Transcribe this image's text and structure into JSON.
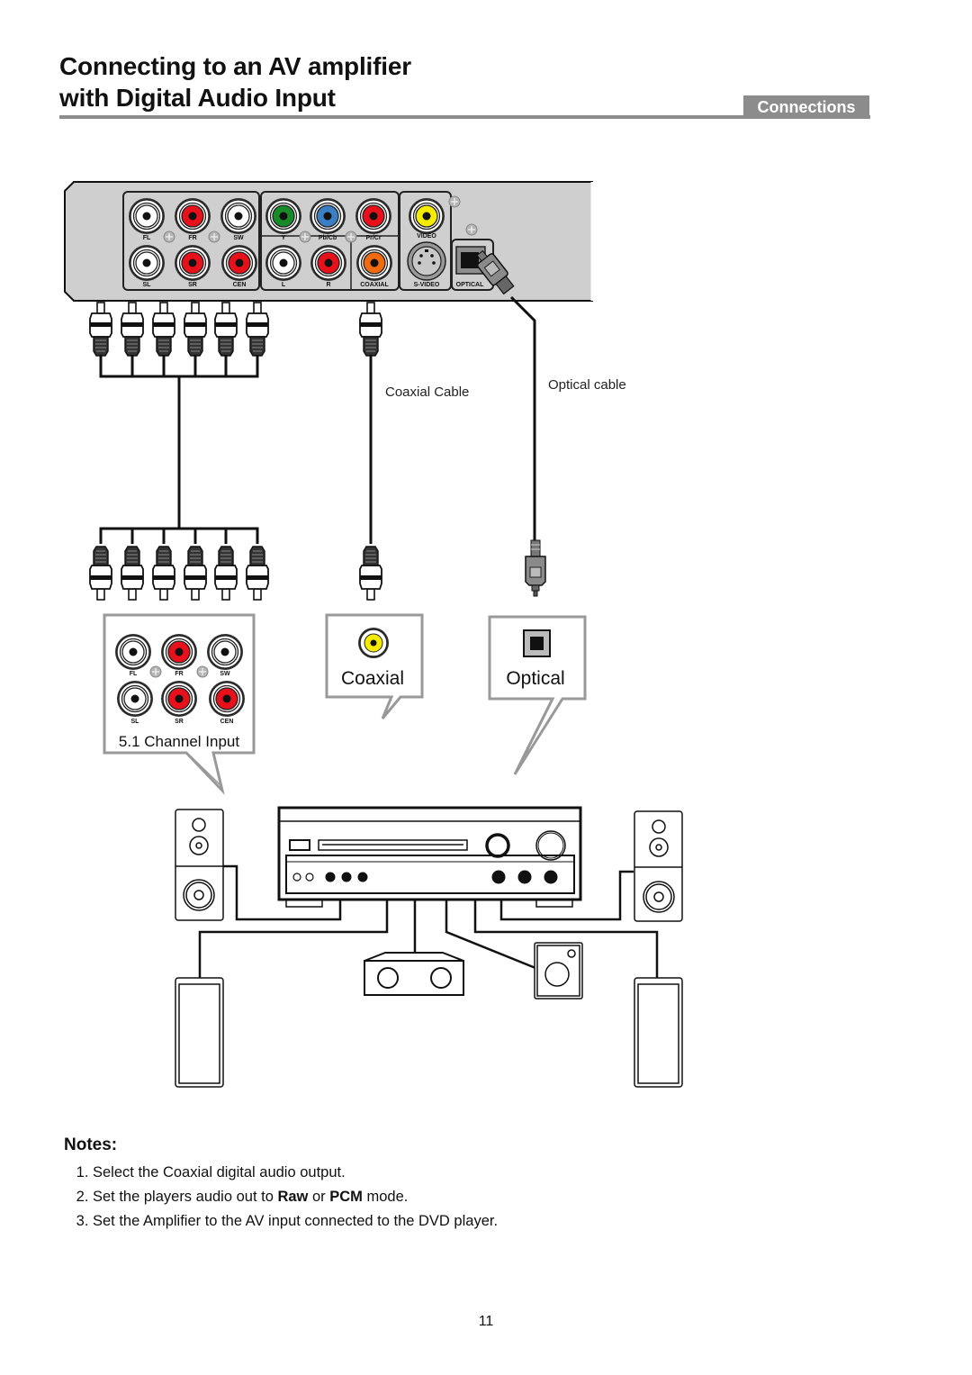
{
  "header": {
    "title_line1": "Connecting to an AV amplifier",
    "title_line2": "with Digital Audio Input",
    "section": "Connections"
  },
  "player_panel": {
    "jacks": [
      {
        "label": "FL",
        "color": "#ffffff"
      },
      {
        "label": "FR",
        "color": "#e8101a"
      },
      {
        "label": "SW",
        "color": "#ffffff"
      },
      {
        "label": "SL",
        "color": "#ffffff"
      },
      {
        "label": "SR",
        "color": "#e8101a"
      },
      {
        "label": "CEN",
        "color": "#e8101a"
      },
      {
        "label": "Y",
        "color": "#178a2a"
      },
      {
        "label": "Pb/Cb",
        "color": "#3a7fc4"
      },
      {
        "label": "Pr/Cr",
        "color": "#e8101a"
      },
      {
        "label": "L",
        "color": "#ffffff"
      },
      {
        "label": "R",
        "color": "#e8101a"
      },
      {
        "label": "COAXIAL",
        "color": "#f26a10"
      },
      {
        "label": "VIDEO",
        "color": "#f5ec00"
      }
    ],
    "svideo_label": "S-VIDEO",
    "optical_label": "OPTICAL"
  },
  "cables": {
    "coaxial": "Coaxial Cable",
    "optical": "Optical cable"
  },
  "callouts": {
    "channel_input": {
      "label": "5.1 Channel Input",
      "jacks": [
        {
          "label": "FL",
          "color": "#ffffff"
        },
        {
          "label": "FR",
          "color": "#e8101a"
        },
        {
          "label": "SW",
          "color": "#ffffff"
        },
        {
          "label": "SL",
          "color": "#ffffff"
        },
        {
          "label": "SR",
          "color": "#e8101a"
        },
        {
          "label": "CEN",
          "color": "#e8101a"
        }
      ]
    },
    "coaxial": {
      "label": "Coaxial",
      "jack_color": "#f5ec00"
    },
    "optical": {
      "label": "Optical"
    }
  },
  "speakers": [
    "front-left",
    "front-right",
    "center",
    "subwoofer",
    "surround-left",
    "surround-right"
  ],
  "notes": {
    "title": "Notes:",
    "items": [
      {
        "text": "Select the Coaxial digital audio output."
      },
      {
        "before": "Set the players audio out to ",
        "bold1": "Raw",
        "middle": " or ",
        "bold2": "PCM",
        "after": " mode."
      },
      {
        "text": "Set the Amplifier to the AV input connected to the DVD player."
      }
    ]
  },
  "page_number": "11"
}
